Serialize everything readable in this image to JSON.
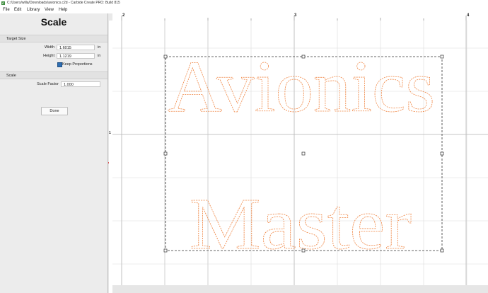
{
  "window": {
    "title": "C:/Users/willa/Downloads/avionics.c2d - Carbide Create PRO: Build 815",
    "app_icon_glyph": "C"
  },
  "menu": {
    "items": [
      "File",
      "Edit",
      "Library",
      "View",
      "Help"
    ]
  },
  "panel": {
    "title": "Scale",
    "target_size": {
      "section_label": "Target Size",
      "width_label": "Width",
      "width_value": "1.6015",
      "width_unit": "in",
      "height_label": "Height",
      "height_value": "1.1219",
      "height_unit": "in",
      "keep_proportions_label": "Keep Proportions",
      "keep_proportions_checked": true
    },
    "scale": {
      "section_label": "Scale",
      "factor_label": "Scale Factor",
      "factor_value": "1.000"
    },
    "done_label": "Done"
  },
  "rulers": {
    "top_labels": [
      "2",
      "3",
      "4"
    ],
    "left_labels": [
      "1"
    ]
  },
  "canvas": {
    "text_line_1": "Avionics",
    "text_line_2": "Master",
    "text_color": "#f08a4a",
    "selection_color": "#333333",
    "grid_color": "#d9d9d9",
    "major_grid_color": "#bdbdbd"
  },
  "icons": {
    "app": "carbide-create-icon",
    "checkbox": "checkbox-checked-icon",
    "handle": "resize-handle-icon"
  }
}
